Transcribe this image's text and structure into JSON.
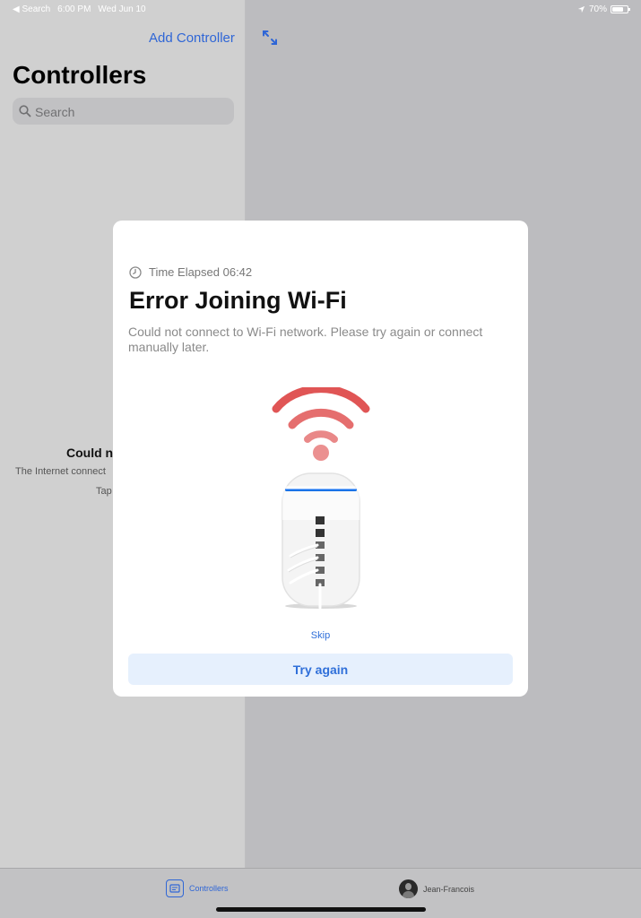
{
  "status_bar": {
    "back_label": "◀ Search",
    "time": "6:00 PM",
    "date": "Wed Jun 10",
    "battery": "70%",
    "battery_level": 0.7
  },
  "sidebar": {
    "add_controller": "Add Controller",
    "title": "Controllers",
    "search_placeholder": "Search",
    "empty_title_partial": "Could n",
    "empty_text_line1": "The Internet connect",
    "empty_text_line2": "Tap"
  },
  "modal": {
    "elapsed_label": "Time Elapsed 06:42",
    "title": "Error Joining Wi-Fi",
    "description": "Could not connect to Wi-Fi network. Please try again or connect manually later.",
    "skip_label": "Skip",
    "try_again_label": "Try again"
  },
  "tabbar": {
    "controllers_label": "Controllers",
    "user_label": "Jean-Francois"
  },
  "colors": {
    "accent": "#2f66d6",
    "wifi_error": "#e05555",
    "led_blue": "#1a73e8"
  },
  "icons": {
    "location": "location-arrow-icon",
    "expand": "expand-arrows-icon",
    "search": "magnifier-icon",
    "clock": "clock-icon",
    "tab_controllers": "controller-icon"
  }
}
